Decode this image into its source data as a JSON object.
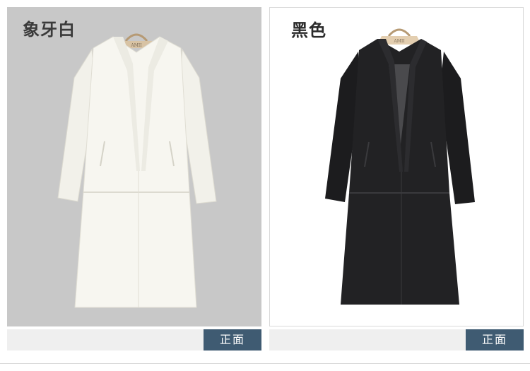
{
  "products": [
    {
      "color_label": "象牙白",
      "view_label": "正面",
      "hanger_tag": "AMII"
    },
    {
      "color_label": "黑色",
      "view_label": "正面",
      "hanger_tag": "AMII"
    }
  ]
}
